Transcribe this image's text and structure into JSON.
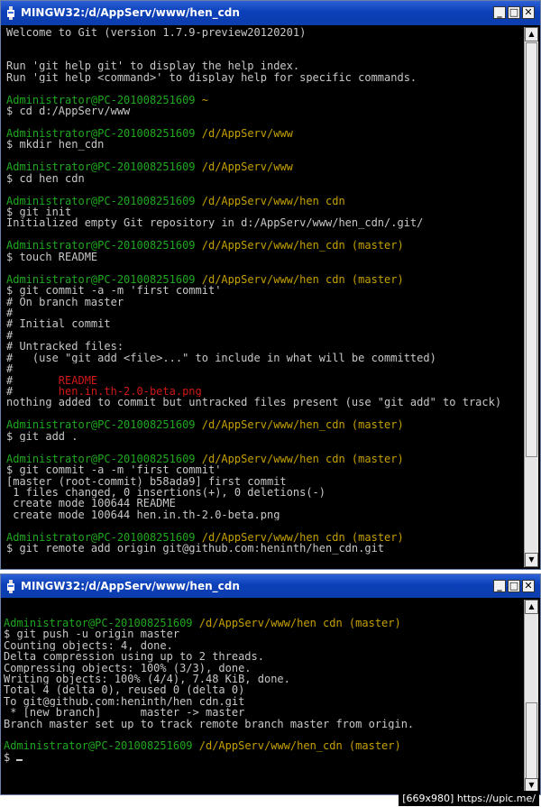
{
  "window1": {
    "title": "MINGW32:/d/AppServ/www/hen_cdn",
    "lines": [
      [
        {
          "t": "Welcome to Git (version 1.7.9-preview20120201)",
          "c": "w"
        }
      ],
      [
        {
          "t": "",
          "c": "w"
        }
      ],
      [
        {
          "t": "",
          "c": "w"
        }
      ],
      [
        {
          "t": "Run 'git help git' to display the help index.",
          "c": "w"
        }
      ],
      [
        {
          "t": "Run 'git help <command>' to display help for specific commands.",
          "c": "w"
        }
      ],
      [
        {
          "t": "",
          "c": "w"
        }
      ],
      [
        {
          "t": "Administrator@PC-201008251609 ",
          "c": "g"
        },
        {
          "t": "~",
          "c": "y"
        }
      ],
      [
        {
          "t": "$ cd d:/AppServ/www",
          "c": "w"
        }
      ],
      [
        {
          "t": "",
          "c": "w"
        }
      ],
      [
        {
          "t": "Administrator@PC-201008251609 ",
          "c": "g"
        },
        {
          "t": "/d/AppServ/www",
          "c": "y"
        }
      ],
      [
        {
          "t": "$ mkdir hen_cdn",
          "c": "w"
        }
      ],
      [
        {
          "t": "",
          "c": "w"
        }
      ],
      [
        {
          "t": "Administrator@PC-201008251609 ",
          "c": "g"
        },
        {
          "t": "/d/AppServ/www",
          "c": "y"
        }
      ],
      [
        {
          "t": "$ cd hen_cdn",
          "c": "w"
        }
      ],
      [
        {
          "t": "",
          "c": "w"
        }
      ],
      [
        {
          "t": "Administrator@PC-201008251609 ",
          "c": "g"
        },
        {
          "t": "/d/AppServ/www/hen_cdn",
          "c": "y"
        }
      ],
      [
        {
          "t": "$ git init",
          "c": "w"
        }
      ],
      [
        {
          "t": "Initialized empty Git repository in d:/AppServ/www/hen_cdn/.git/",
          "c": "w"
        }
      ],
      [
        {
          "t": "",
          "c": "w"
        }
      ],
      [
        {
          "t": "Administrator@PC-201008251609 ",
          "c": "g"
        },
        {
          "t": "/d/AppServ/www/hen_cdn (master)",
          "c": "y"
        }
      ],
      [
        {
          "t": "$ touch README",
          "c": "w"
        }
      ],
      [
        {
          "t": "",
          "c": "w"
        }
      ],
      [
        {
          "t": "Administrator@PC-201008251609 ",
          "c": "g"
        },
        {
          "t": "/d/AppServ/www/hen_cdn (master)",
          "c": "y"
        }
      ],
      [
        {
          "t": "$ git commit -a -m 'first commit'",
          "c": "w"
        }
      ],
      [
        {
          "t": "# On branch master",
          "c": "w"
        }
      ],
      [
        {
          "t": "#",
          "c": "w"
        }
      ],
      [
        {
          "t": "# Initial commit",
          "c": "w"
        }
      ],
      [
        {
          "t": "#",
          "c": "w"
        }
      ],
      [
        {
          "t": "# Untracked files:",
          "c": "w"
        }
      ],
      [
        {
          "t": "#   (use \"git add <file>...\" to include in what will be committed)",
          "c": "w"
        }
      ],
      [
        {
          "t": "#",
          "c": "w"
        }
      ],
      [
        {
          "t": "#       ",
          "c": "w"
        },
        {
          "t": "README",
          "c": "r"
        }
      ],
      [
        {
          "t": "#       ",
          "c": "w"
        },
        {
          "t": "hen.in.th-2.0-beta.png",
          "c": "r"
        }
      ],
      [
        {
          "t": "nothing added to commit but untracked files present (use \"git add\" to track)",
          "c": "w"
        }
      ],
      [
        {
          "t": "",
          "c": "w"
        }
      ],
      [
        {
          "t": "Administrator@PC-201008251609 ",
          "c": "g"
        },
        {
          "t": "/d/AppServ/www/hen_cdn (master)",
          "c": "y"
        }
      ],
      [
        {
          "t": "$ git add .",
          "c": "w"
        }
      ],
      [
        {
          "t": "",
          "c": "w"
        }
      ],
      [
        {
          "t": "Administrator@PC-201008251609 ",
          "c": "g"
        },
        {
          "t": "/d/AppServ/www/hen_cdn (master)",
          "c": "y"
        }
      ],
      [
        {
          "t": "$ git commit -a -m 'first commit'",
          "c": "w"
        }
      ],
      [
        {
          "t": "[master (root-commit) b58ada9] first commit",
          "c": "w"
        }
      ],
      [
        {
          "t": " 1 files changed, 0 insertions(+), 0 deletions(-)",
          "c": "w"
        }
      ],
      [
        {
          "t": " create mode 100644 README",
          "c": "w"
        }
      ],
      [
        {
          "t": " create mode 100644 hen.in.th-2.0-beta.png",
          "c": "w"
        }
      ],
      [
        {
          "t": "",
          "c": "w"
        }
      ],
      [
        {
          "t": "Administrator@PC-201008251609 ",
          "c": "g"
        },
        {
          "t": "/d/AppServ/www/hen_cdn (master)",
          "c": "y"
        }
      ],
      [
        {
          "t": "$ git remote add origin git@github.com:heninth/hen_cdn.git",
          "c": "w"
        }
      ]
    ]
  },
  "window2": {
    "title": "MINGW32:/d/AppServ/www/hen_cdn",
    "lines": [
      [
        {
          "t": "Administrator@PC-201008251609 ",
          "c": "g"
        },
        {
          "t": "/d/AppServ/www/hen_cdn (master)",
          "c": "y"
        }
      ],
      [
        {
          "t": "$ git push -u origin master",
          "c": "w"
        }
      ],
      [
        {
          "t": "Counting objects: 4, done.",
          "c": "w"
        }
      ],
      [
        {
          "t": "Delta compression using up to 2 threads.",
          "c": "w"
        }
      ],
      [
        {
          "t": "Compressing objects: 100% (3/3), done.",
          "c": "w"
        }
      ],
      [
        {
          "t": "Writing objects: 100% (4/4), 7.48 KiB, done.",
          "c": "w"
        }
      ],
      [
        {
          "t": "Total 4 (delta 0), reused 0 (delta 0)",
          "c": "w"
        }
      ],
      [
        {
          "t": "To git@github.com:heninth/hen_cdn.git",
          "c": "w"
        }
      ],
      [
        {
          "t": " * [new branch]      master -> master",
          "c": "w"
        }
      ],
      [
        {
          "t": "Branch master set up to track remote branch master from origin.",
          "c": "w"
        }
      ],
      [
        {
          "t": "",
          "c": "w"
        }
      ],
      [
        {
          "t": "Administrator@PC-201008251609 ",
          "c": "g"
        },
        {
          "t": "/d/AppServ/www/hen_cdn (master)",
          "c": "y"
        }
      ],
      [
        {
          "t": "$ ",
          "c": "w"
        }
      ]
    ]
  },
  "watermark": "[669x980] https://upic.me/"
}
